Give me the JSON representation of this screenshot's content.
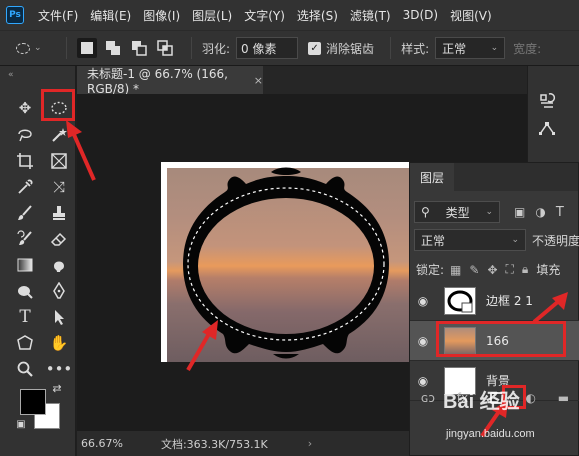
{
  "app": {
    "logo": "Ps"
  },
  "menu": [
    "文件(F)",
    "编辑(E)",
    "图像(I)",
    "图层(L)",
    "文字(Y)",
    "选择(S)",
    "滤镜(T)",
    "3D(D)",
    "视图(V)"
  ],
  "options": {
    "feather_label": "羽化:",
    "feather_value": "0 像素",
    "antialias_label": "消除锯齿",
    "style_label": "样式:",
    "style_value": "正常",
    "width_label": "宽度:"
  },
  "document": {
    "tab_title": "未标题-1 @ 66.7% (166, RGB/8) *",
    "close": "×"
  },
  "status": {
    "zoom": "66.67%",
    "doc_info": "文档:363.3K/753.1K"
  },
  "layers_panel": {
    "tab": "图层",
    "filter_label": "类型",
    "blend_mode": "正常",
    "opacity_label": "不透明度",
    "lock_label": "锁定:",
    "fill_label": "填充",
    "layers": [
      {
        "name": "边框 2 1",
        "selected": false
      },
      {
        "name": "166",
        "selected": true
      },
      {
        "name": "背景",
        "selected": false
      }
    ],
    "footer_link": "ɢɔ",
    "footer_fx": "fx"
  },
  "watermark": {
    "main": "Bai 经验",
    "sub": "jingyan.baidu.com"
  },
  "colors": {
    "annotation_red": "#e02727",
    "ps_blue": "#31a8ff",
    "panel_bg": "#383838"
  },
  "icons": [
    "move-icon",
    "elliptical-marquee-icon",
    "lasso-icon",
    "magic-wand-icon",
    "crop-icon",
    "frame-icon",
    "eyedropper-icon",
    "healing-icon",
    "brush-icon",
    "stamp-icon",
    "history-brush-icon",
    "eraser-icon",
    "gradient-icon",
    "blur-icon",
    "dodge-icon",
    "pen-icon",
    "type-icon",
    "path-select-icon",
    "hand-icon",
    "zoom-icon",
    "more-icon"
  ]
}
